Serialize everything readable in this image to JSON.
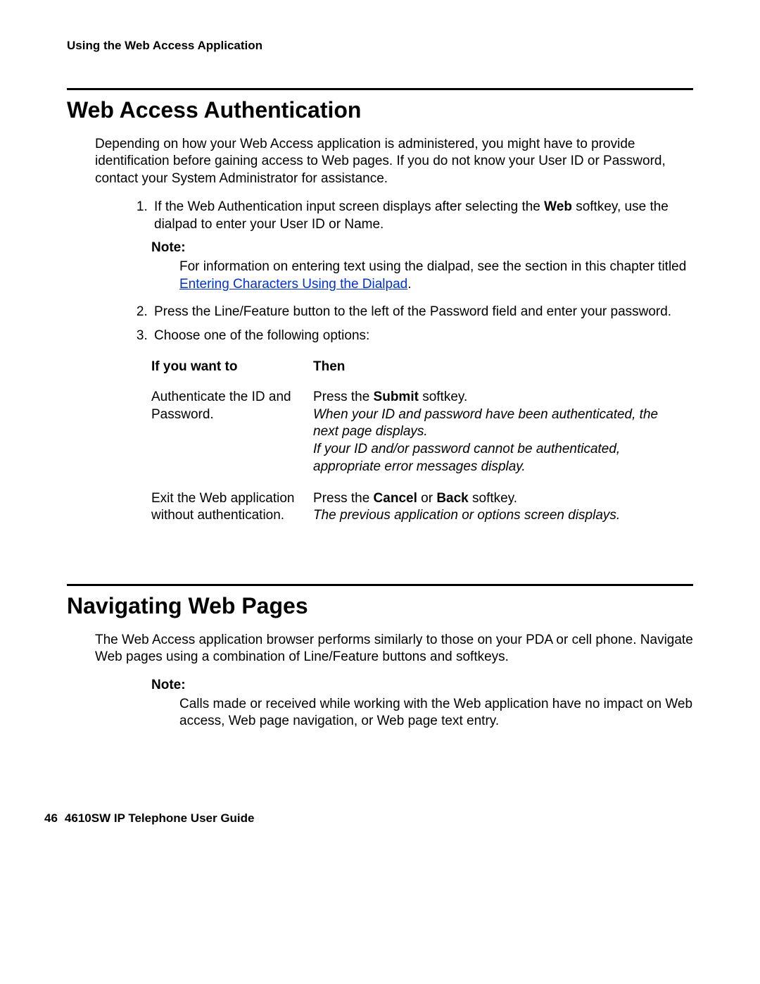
{
  "runningHead": "Using the Web Access Application",
  "section1": {
    "title": "Web Access Authentication",
    "intro": "Depending on how your Web Access application is administered, you might have to provide identification before gaining access to Web pages. If you do not know your User ID or Password, contact your System Administrator for assistance.",
    "step1_pre": "If the Web Authentication input screen displays after selecting the ",
    "step1_bold": "Web",
    "step1_post": " softkey, use the dialpad to enter your User ID or Name.",
    "noteLabel": "Note:",
    "noteBody_pre": "For information on entering text using the dialpad, see the section in this chapter titled ",
    "noteLink": "Entering Characters Using the Dialpad",
    "noteBody_post": ".",
    "step2": "Press the Line/Feature button to the left of the Password field and enter your password.",
    "step3": "Choose one of the following options:",
    "table": {
      "h1": "If you want to",
      "h2": "Then",
      "r1c1": "Authenticate the ID and Password.",
      "r1c2_pre": "Press the ",
      "r1c2_bold": "Submit",
      "r1c2_post": " softkey.",
      "r1c2_i1": "When your ID and password have been authenticated, the next page displays.",
      "r1c2_i2": "If your ID and/or password cannot be authenticated, appropriate error messages display.",
      "r2c1": "Exit the Web application without authentication.",
      "r2c2_pre": "Press the ",
      "r2c2_b1": "Cancel",
      "r2c2_mid": " or ",
      "r2c2_b2": "Back",
      "r2c2_post": " softkey.",
      "r2c2_i1": "The previous application or options screen displays."
    }
  },
  "section2": {
    "title": "Navigating Web Pages",
    "intro": "The Web Access application browser performs similarly to those on your PDA or cell phone. Navigate Web pages using a combination of Line/Feature buttons and softkeys.",
    "noteLabel": "Note:",
    "noteBody": "Calls made or received while working with the Web application have no impact on Web access, Web page navigation, or Web page text entry."
  },
  "footer": {
    "page": "46",
    "title": "4610SW IP Telephone User Guide"
  }
}
